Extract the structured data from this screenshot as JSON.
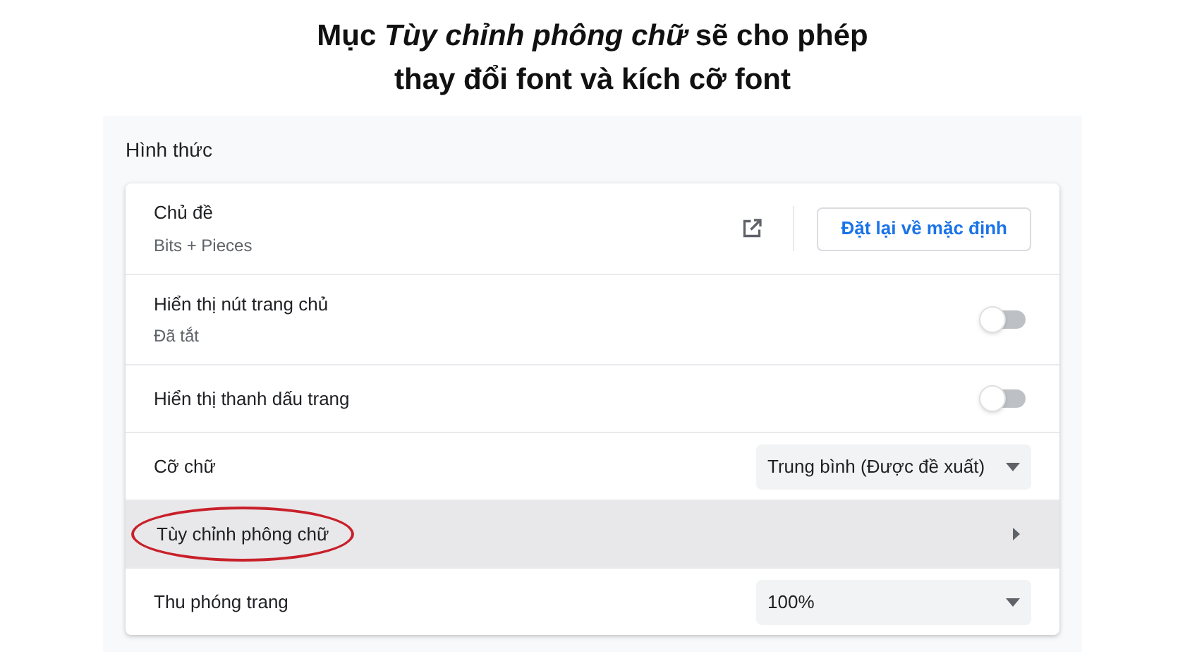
{
  "caption": {
    "lines": [
      "Mục *Tùy chỉnh phông chữ* sẽ cho phép",
      "thay đổi font và kích cỡ font"
    ]
  },
  "section": {
    "title": "Hình thức"
  },
  "rows": [
    {
      "kind": "theme",
      "label": "Chủ đề",
      "sublabel": "Bits + Pieces",
      "button": "Đặt lại về mặc định",
      "highlighted": false,
      "annotated": false
    },
    {
      "kind": "toggle",
      "label": "Hiển thị nút trang chủ",
      "sublabel": "Đã tắt",
      "on": false,
      "highlighted": false,
      "annotated": false
    },
    {
      "kind": "toggle",
      "label": "Hiển thị thanh dấu trang",
      "on": false,
      "highlighted": false,
      "annotated": false
    },
    {
      "kind": "select",
      "label": "Cỡ chữ",
      "value": "Trung bình (Được đề xuất)",
      "highlighted": false,
      "annotated": false
    },
    {
      "kind": "submenu",
      "label": "Tùy chỉnh phông chữ",
      "highlighted": true,
      "annotated": true
    },
    {
      "kind": "select",
      "label": "Thu phóng trang",
      "value": "100%",
      "highlighted": false,
      "annotated": false
    }
  ]
}
